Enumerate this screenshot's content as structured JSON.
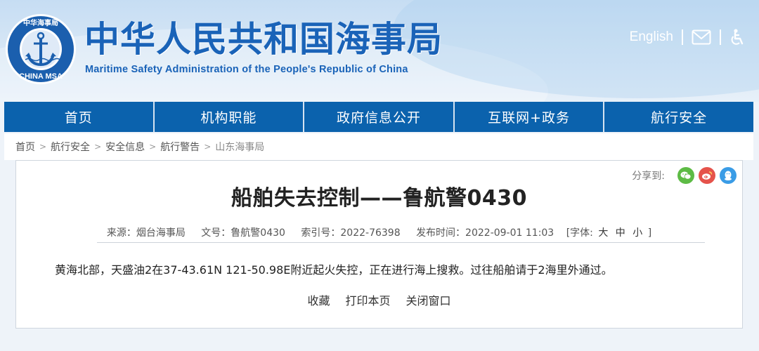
{
  "header": {
    "title": "中华人民共和国海事局",
    "subtitle": "Maritime Safety Administration of the People's Republic of China",
    "logo_text_top": "中华海事局",
    "logo_text_bottom": "CHINA MSA",
    "english_link": "English",
    "icons": [
      "mail-icon",
      "accessibility-icon"
    ]
  },
  "nav": {
    "items": [
      {
        "label": "首页"
      },
      {
        "label": "机构职能"
      },
      {
        "label": "政府信息公开"
      },
      {
        "label": "互联网+政务"
      },
      {
        "label": "航行安全"
      }
    ]
  },
  "breadcrumb": {
    "items": [
      "首页",
      "航行安全",
      "安全信息",
      "航行警告",
      "山东海事局"
    ]
  },
  "share": {
    "label": "分享到:",
    "icons": [
      "wechat-icon",
      "weibo-icon",
      "qq-icon"
    ]
  },
  "article": {
    "title": "船舶失去控制——鲁航警0430",
    "meta": {
      "source": "来源：烟台海事局",
      "doc_no": "文号：鲁航警0430",
      "index_no": "索引号：2022-76398",
      "publish_time": "发布时间：2022-09-01 11:03",
      "font_label": "[字体:",
      "font_large": "大",
      "font_medium": "中",
      "font_small": "小",
      "font_close": "]"
    },
    "body": "黄海北部，天盛油2在37-43.61N 121-50.98E附近起火失控，正在进行海上搜救。过往船舶请于2海里外通过。"
  },
  "actions": {
    "favorite": "收藏",
    "print": "打印本页",
    "close": "关闭窗口"
  },
  "colors": {
    "brand_blue": "#1a63b8",
    "nav_blue": "#0b62ad",
    "wechat": "#5dbb45",
    "weibo": "#e5534b",
    "qq": "#3a9ce6"
  }
}
